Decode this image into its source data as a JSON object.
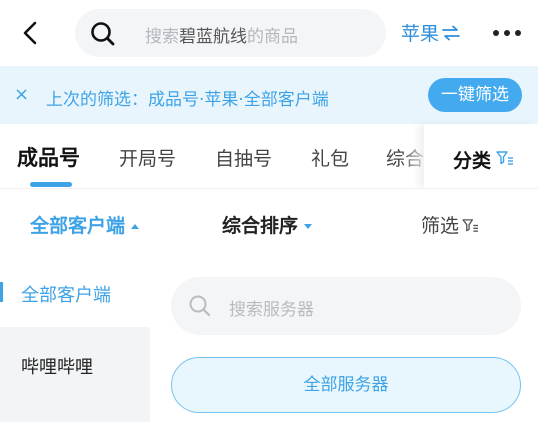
{
  "header": {
    "search_prefix": "搜索",
    "search_highlight": "碧蓝航线",
    "search_suffix": "的商品",
    "platform_label": "苹果"
  },
  "banner": {
    "close": "×",
    "text": "上次的筛选：成品号·苹果·全部客户端",
    "button": "一键筛选"
  },
  "tabs": [
    {
      "label": "成品号"
    },
    {
      "label": "开局号"
    },
    {
      "label": "自抽号"
    },
    {
      "label": "礼包"
    },
    {
      "label": "综合"
    }
  ],
  "category": {
    "label": "分类"
  },
  "sort": {
    "client": "全部客户端",
    "order": "综合排序",
    "filter": "筛选"
  },
  "left_menu": [
    {
      "label": "全部客户端"
    },
    {
      "label": "哔哩哔哩"
    }
  ],
  "server": {
    "search_placeholder": "搜索服务器",
    "all_button": "全部服务器"
  },
  "colors": {
    "accent": "#3ea3e6",
    "banner_bg": "#e9f5fd",
    "button_bg": "#44aaf0"
  },
  "icons": [
    "back-arrow-icon",
    "search-icon",
    "swap-icon",
    "more-icon",
    "close-icon",
    "filter-icon",
    "caret-up-icon",
    "caret-down-icon"
  ]
}
